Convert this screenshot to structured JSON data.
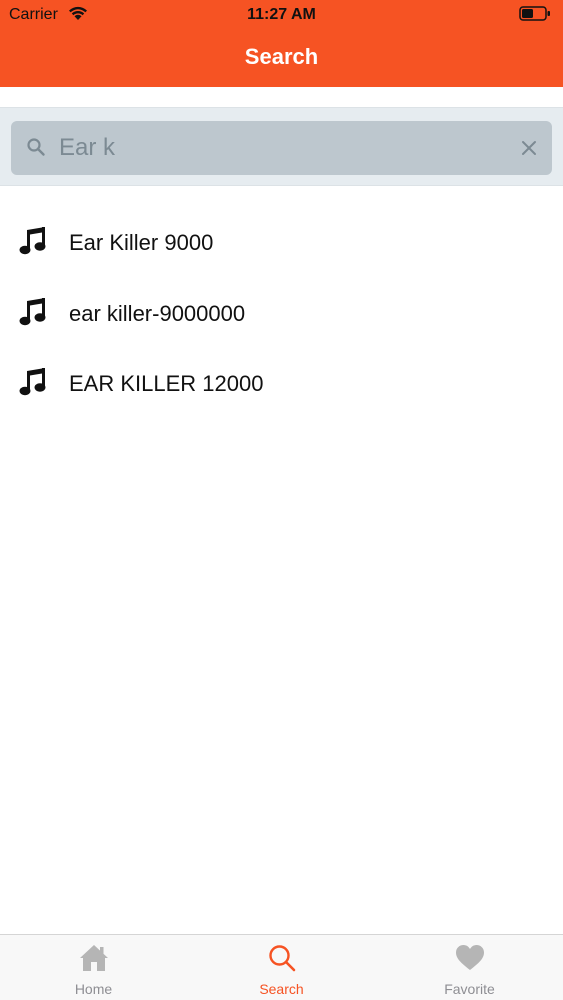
{
  "status_bar": {
    "carrier": "Carrier",
    "time": "11:27 AM"
  },
  "nav": {
    "title": "Search"
  },
  "search": {
    "value": "Ear k",
    "placeholder": ""
  },
  "results": [
    {
      "label": "Ear Killer 9000"
    },
    {
      "label": "ear killer-9000000"
    },
    {
      "label": "EAR KILLER 12000"
    }
  ],
  "tabs": [
    {
      "label": "Home",
      "icon": "home-icon",
      "active": false
    },
    {
      "label": "Search",
      "icon": "search-icon",
      "active": true
    },
    {
      "label": "Favorite",
      "icon": "heart-icon",
      "active": false
    }
  ],
  "colors": {
    "accent": "#F65323",
    "inactive_tab": "#8E8E93",
    "search_bg": "#BDC7CE"
  }
}
